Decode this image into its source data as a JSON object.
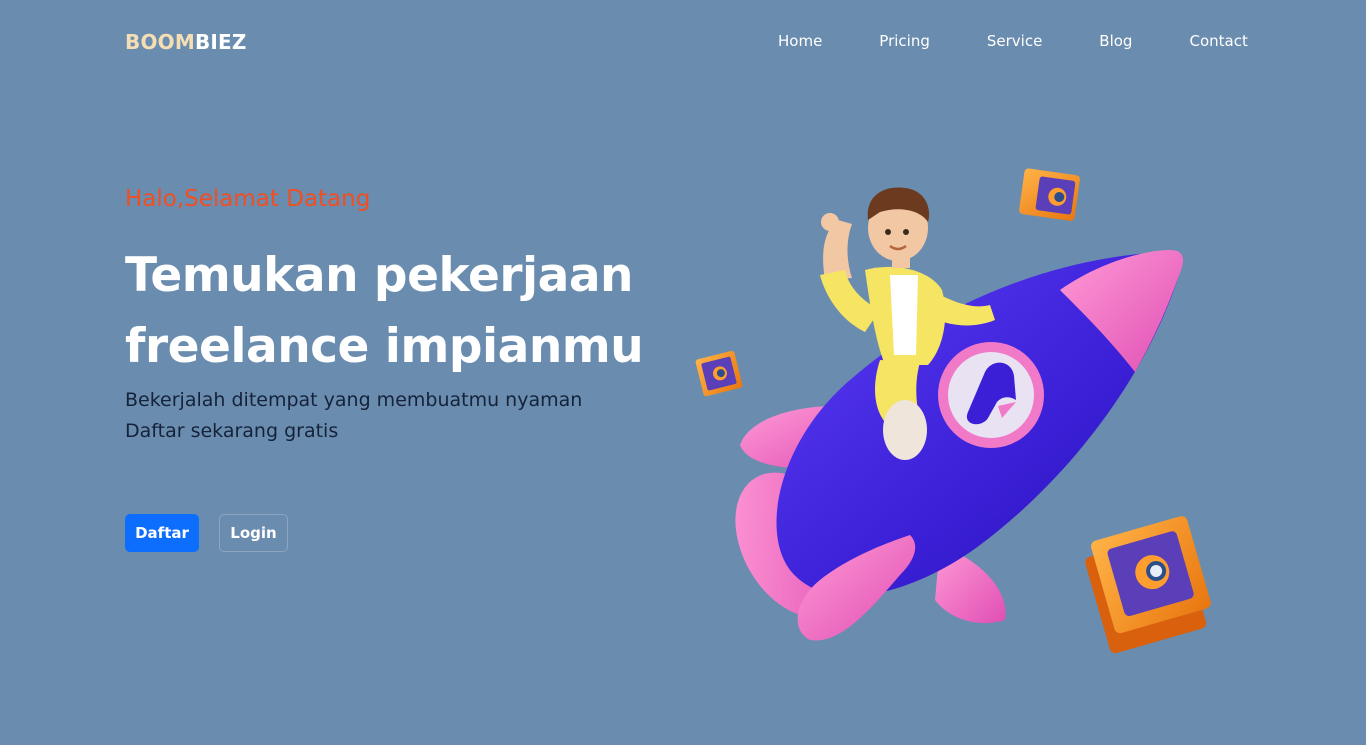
{
  "colors": {
    "background": "#6a8caf",
    "brand_accent": "#f5deb3",
    "primary": "#0d6efd",
    "greeting": "#f04e23"
  },
  "nav": {
    "brand_part1": "BOOM",
    "brand_part2": "BIEZ",
    "links": [
      "Home",
      "Pricing",
      "Service",
      "Blog",
      "Contact"
    ]
  },
  "hero": {
    "greeting": "Halo,Selamat Datang",
    "headline": "Temukan pekerjaan freelance impianmu",
    "subtext": "Bekerjalah ditempat yang membuatmu nyaman Daftar sekarang gratis",
    "primary_button": "Daftar",
    "secondary_button": "Login"
  },
  "illustration": {
    "icons": [
      "rocket-icon",
      "character-waving",
      "blender-cube-icon"
    ]
  }
}
